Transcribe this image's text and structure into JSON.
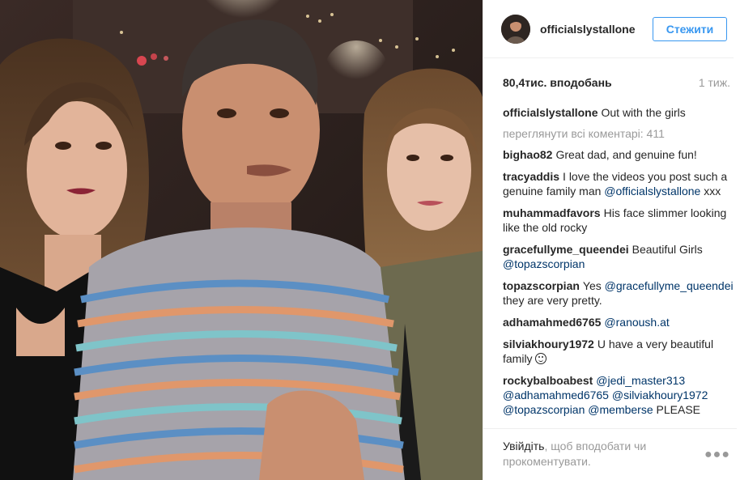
{
  "post": {
    "username": "officialslystallone",
    "follow_label": "Стежити",
    "likes": "80,4тис. вподобань",
    "time": "1 тиж.",
    "caption": {
      "author": "officialslystallone",
      "text": "Out with the girls"
    },
    "view_all": "переглянути всі коментарі: 411",
    "comments": [
      {
        "author": "bighao82",
        "parts": [
          {
            "t": "Great dad, and genuine fun!"
          }
        ]
      },
      {
        "author": "tracyaddis",
        "parts": [
          {
            "t": "I love the videos you post such a genuine family man "
          },
          {
            "m": "@officialslystallone"
          },
          {
            "t": " xxx"
          }
        ]
      },
      {
        "author": "muhammadfavors",
        "parts": [
          {
            "t": "His face slimmer looking like the old rocky"
          }
        ]
      },
      {
        "author": "gracefullyme_queendei",
        "parts": [
          {
            "t": "Beautiful Girls "
          },
          {
            "m": "@topazscorpian"
          }
        ]
      },
      {
        "author": "topazscorpian",
        "parts": [
          {
            "t": "Yes "
          },
          {
            "m": "@gracefullyme_queendei"
          },
          {
            "t": " they are very pretty."
          }
        ]
      },
      {
        "author": "adhamahmed6765",
        "parts": [
          {
            "m": "@ranoush.at"
          }
        ]
      },
      {
        "author": "silviakhoury1972",
        "parts": [
          {
            "t": "U have a very beautiful family "
          },
          {
            "e": "smile"
          }
        ]
      },
      {
        "author": "rockybalboabest",
        "parts": [
          {
            "m": "@jedi_master313"
          },
          {
            "t": " "
          },
          {
            "m": "@adhamahmed6765"
          },
          {
            "t": " "
          },
          {
            "m": "@silviakhoury1972"
          },
          {
            "t": " "
          },
          {
            "m": "@topazscorpian"
          },
          {
            "t": " "
          },
          {
            "m": "@memberse"
          },
          {
            "t": " PLEASE"
          }
        ]
      }
    ],
    "footer": {
      "login": "Увійдіть",
      "rest": ", щоб вподобати чи прокоментувати."
    },
    "more_icon": "ooo"
  },
  "icons": {
    "avatar": "avatar-photo",
    "more": "ellipsis-icon",
    "smile": "smile-emoji-icon"
  },
  "colors": {
    "accent": "#3897f0",
    "mention": "#003569",
    "muted": "#999999"
  }
}
